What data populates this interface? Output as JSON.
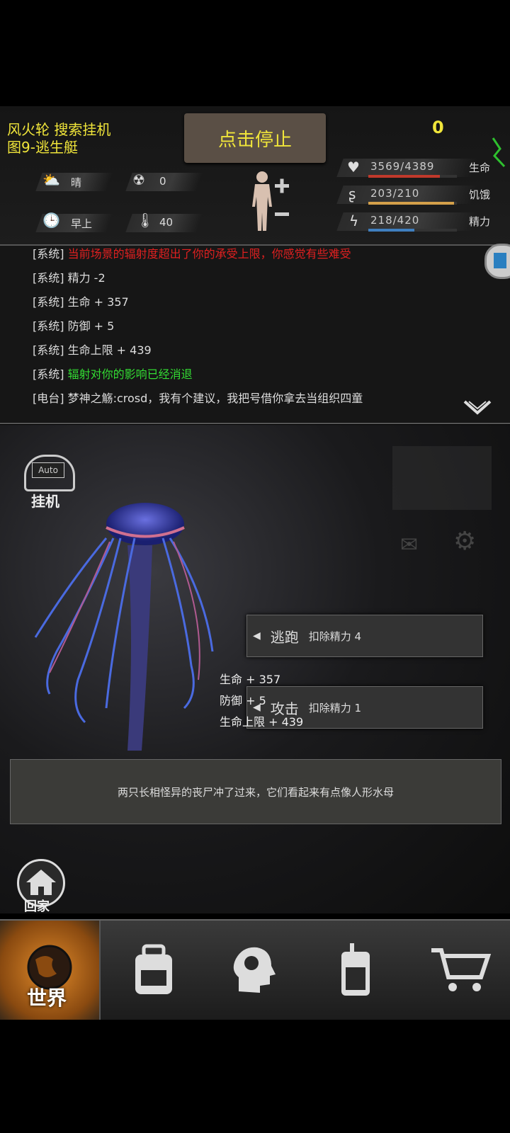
{
  "header": {
    "line1": "风火轮  搜索挂机",
    "line2": "图9-逃生艇",
    "stop_button": "点击停止",
    "counter": "0"
  },
  "env": {
    "weather": "晴",
    "radiation": "0",
    "time_of_day": "早上",
    "temperature": "40"
  },
  "stats": {
    "health": {
      "value": "3569/4389",
      "label": "生命",
      "fraction": 0.81,
      "color": "#c0392b"
    },
    "hunger": {
      "value": "203/210",
      "label": "饥饿",
      "fraction": 0.97,
      "color": "#d4a04a"
    },
    "energy": {
      "value": "218/420",
      "label": "精力",
      "fraction": 0.52,
      "color": "#3f7fbf"
    }
  },
  "log": [
    {
      "prefix": "[系统]",
      "text": "当前场景的辐射度超出了你的承受上限，你感觉有些难受",
      "color": "#e02020"
    },
    {
      "prefix": "[系统]",
      "text": "精力 -2",
      "color": "#dddddd"
    },
    {
      "prefix": "[系统]",
      "text": "生命 + 357",
      "color": "#dddddd"
    },
    {
      "prefix": "[系统]",
      "text": "防御 + 5",
      "color": "#dddddd"
    },
    {
      "prefix": "[系统]",
      "text": "生命上限 + 439",
      "color": "#dddddd"
    },
    {
      "prefix": "[系统]",
      "text": "辐射对你的影响已经消退",
      "color": "#33dd33"
    },
    {
      "prefix": "[电台]",
      "text": "梦神之觞:crosd，我有个建议，我把号借你拿去当组织四童",
      "color": "#dddddd"
    }
  ],
  "scene": {
    "auto_label": "Auto",
    "idle_label": "挂机",
    "go_home_label": "回家",
    "flee_label": "逃跑",
    "flee_cost": "扣除精力 4",
    "attack_label": "攻击",
    "attack_cost": "扣除精力 1",
    "float_stats": [
      "生命 + 357",
      "防御 + 5",
      "生命上限 + 439"
    ],
    "caption": "两只长相怪异的丧尸冲了过来，它们看起来有点像人形水母"
  },
  "nav": {
    "world_label": "世界",
    "items": [
      "globe-icon",
      "backpack-icon",
      "brain-icon",
      "radio-icon",
      "cart-icon"
    ]
  }
}
